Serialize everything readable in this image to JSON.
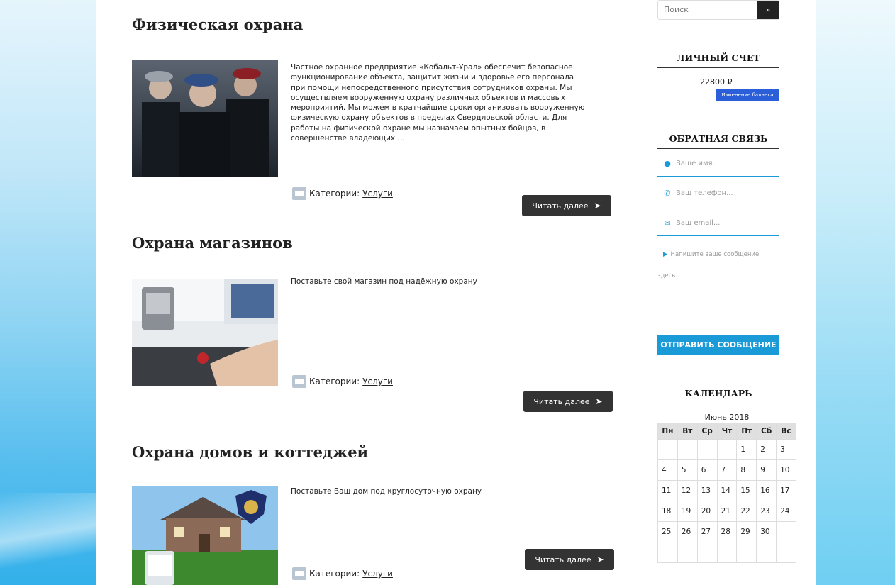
{
  "posts": [
    {
      "title": "Физическая охрана",
      "excerpt_lines": [
        "Частное охранное предприятие «Кобальт-Урал» обеспечит безопасное",
        "функционирование объекта, защитит жизни и здоровье его персонала",
        "при помощи непосредственного присутствия сотрудников охраны. Мы",
        "осуществляем вооруженную охрану различных объектов и массовых",
        "мероприятий. Мы можем в кратчайшие сроки организовать вооруженную",
        "физическую охрану объектов в пределах Свердловской области. Для",
        "работы на физической охране мы назначаем опытных бойцов, в",
        "совершенстве владеющих …"
      ],
      "categories_label": "Категории:",
      "category": "Услуги",
      "read_more": "Читать далее"
    },
    {
      "title": "Охрана магазинов",
      "excerpt_lines": [
        "Поставьте свой магазин под надёжную охрану"
      ],
      "categories_label": "Категории:",
      "category": "Услуги",
      "read_more": "Читать далее"
    },
    {
      "title": "Охрана домов и коттеджей",
      "excerpt_lines": [
        "Поставьте Ваш дом под круглосуточную охрану"
      ],
      "categories_label": "Категории:",
      "category": "Услуги",
      "read_more": "Читать далее"
    }
  ],
  "sidebar": {
    "search_placeholder": "Поиск",
    "search_button": "»",
    "account_title": "ЛИЧНЫЙ СЧЕТ",
    "balance": "22800 ₽",
    "balance_button": "Изменение баланса",
    "feedback_title": "ОБРАТНАЯ СВЯЗЬ",
    "name_placeholder": "Ваше имя...",
    "phone_placeholder": "Ваш телефон...",
    "email_placeholder": "Ваш email...",
    "message_line1": "Напишите ваше сообщение",
    "message_line2": "здесь...",
    "send_button": "ОТПРАВИТЬ СООБЩЕНИЕ",
    "calendar_title": "КАЛЕНДАРЬ",
    "calendar_caption": "Июнь 2018",
    "weekdays": [
      "Пн",
      "Вт",
      "Ср",
      "Чт",
      "Пт",
      "Сб",
      "Вс"
    ],
    "weeks": [
      [
        "",
        "",
        "",
        "",
        "1",
        "2",
        "3"
      ],
      [
        "4",
        "5",
        "6",
        "7",
        "8",
        "9",
        "10"
      ],
      [
        "11",
        "12",
        "13",
        "14",
        "15",
        "16",
        "17"
      ],
      [
        "18",
        "19",
        "20",
        "21",
        "22",
        "23",
        "24"
      ],
      [
        "25",
        "26",
        "27",
        "28",
        "29",
        "30",
        ""
      ],
      [
        "",
        "",
        "",
        "",
        "",
        "",
        ""
      ]
    ]
  },
  "icons": [
    "folder-icon",
    "arrow-right-icon",
    "user-icon",
    "phone-icon",
    "envelope-icon",
    "comment-icon"
  ]
}
